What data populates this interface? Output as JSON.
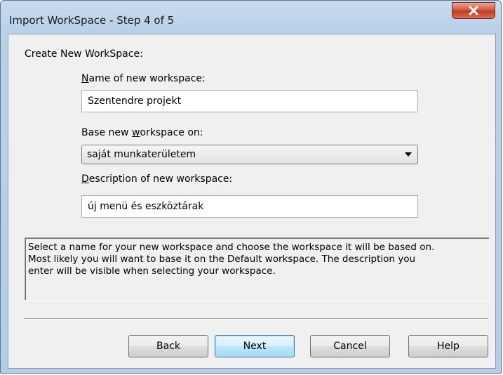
{
  "window": {
    "title": "Import WorkSpace - Step 4 of 5",
    "close_icon": "close-x-icon"
  },
  "form": {
    "section_label": "Create New WorkSpace:",
    "name": {
      "label_mnemonic": "N",
      "label_rest": "ame of new workspace:",
      "value": "Szentendre projekt"
    },
    "base": {
      "label_before": "Base new ",
      "label_mnemonic": "w",
      "label_after": "orkspace on:",
      "selected": "saját munkaterületem",
      "arrow_icon": "dropdown-arrow-icon"
    },
    "description": {
      "label_mnemonic": "D",
      "label_rest": "escription of new workspace:",
      "value": "új menü és eszköztárak"
    }
  },
  "help": {
    "lines": [
      "Select a name for your new workspace and choose the workspace it will be based on.",
      "Most likely you will want to base it on the Default workspace. The description you",
      "enter will be visible when selecting your workspace."
    ]
  },
  "buttons": {
    "back": "Back",
    "next": "Next",
    "cancel": "Cancel",
    "help": "Help"
  },
  "colors": {
    "title_bar": "#b9d1e9",
    "close_button": "#c7432a",
    "dialog_bg": "#f0f0f0",
    "default_button_border": "#3c7fb1"
  }
}
